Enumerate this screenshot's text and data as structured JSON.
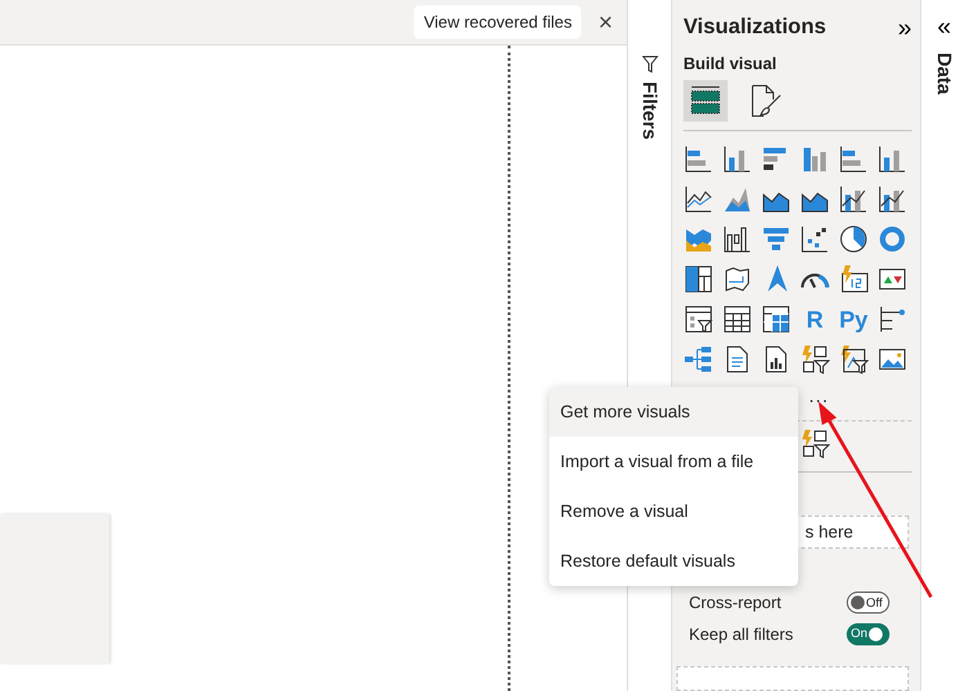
{
  "canvas": {
    "recovered_button": "View recovered files",
    "close": "×"
  },
  "filters_pane": {
    "title": "Filters"
  },
  "visualizations": {
    "title": "Visualizations",
    "collapse": "»",
    "section": "Build visual",
    "modes": [
      {
        "kind": "build",
        "selected": true
      },
      {
        "kind": "format",
        "selected": false
      }
    ],
    "icon_texts": [
      "R",
      "Py"
    ],
    "more": "...",
    "drill_field": {
      "placeholder": "s here"
    },
    "toggles": [
      {
        "label": "Cross-report",
        "on": false,
        "state": "Off"
      },
      {
        "label": "Keep all filters",
        "on": true,
        "state": "On"
      }
    ]
  },
  "data_pane": {
    "expand": "«",
    "title": "Data"
  },
  "context_menu": [
    {
      "label": "Get more visuals",
      "hovered": true
    },
    {
      "label": "Import a visual from a file",
      "hovered": false
    },
    {
      "label": "Remove a visual",
      "hovered": false
    },
    {
      "label": "Restore default visuals",
      "hovered": false
    }
  ]
}
